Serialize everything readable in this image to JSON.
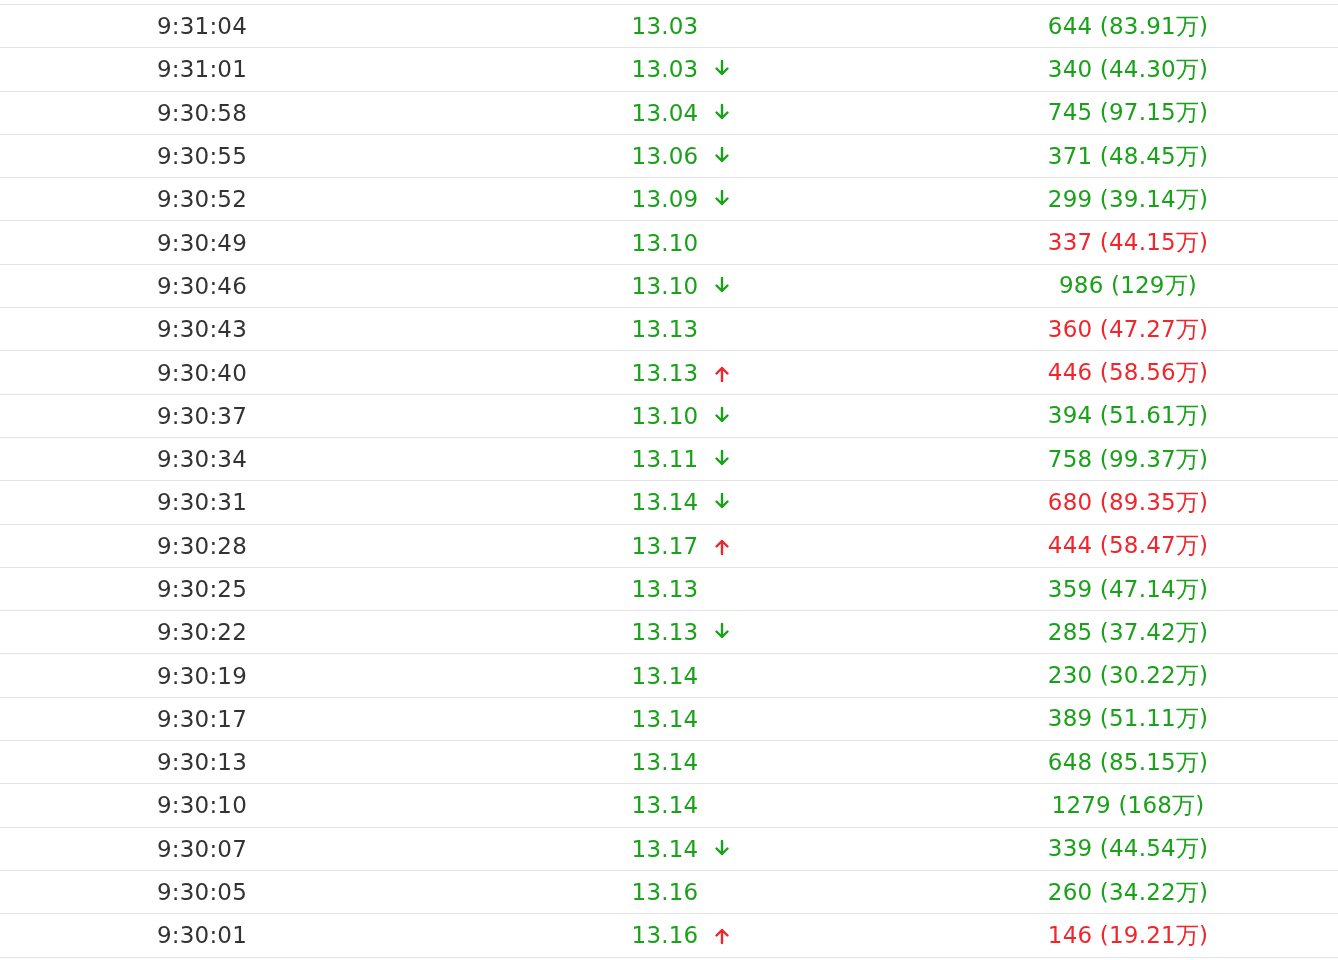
{
  "rows": [
    {
      "time": "9:31:04",
      "price": "13.03",
      "up": false,
      "down": false,
      "volume": "644 (83.91万)",
      "color": "#1aa11a"
    },
    {
      "time": "9:31:01",
      "price": "13.03",
      "up": false,
      "down": true,
      "volume": "340 (44.30万)",
      "color": "#1aa11a"
    },
    {
      "time": "9:30:58",
      "price": "13.04",
      "up": false,
      "down": true,
      "volume": "745 (97.15万)",
      "color": "#1aa11a"
    },
    {
      "time": "9:30:55",
      "price": "13.06",
      "up": false,
      "down": true,
      "volume": "371 (48.45万)",
      "color": "#1aa11a"
    },
    {
      "time": "9:30:52",
      "price": "13.09",
      "up": false,
      "down": true,
      "volume": "299 (39.14万)",
      "color": "#1aa11a"
    },
    {
      "time": "9:30:49",
      "price": "13.10",
      "up": false,
      "down": false,
      "volume": "337 (44.15万)",
      "color": "#f0262c"
    },
    {
      "time": "9:30:46",
      "price": "13.10",
      "up": false,
      "down": true,
      "volume": "986 (129万)",
      "color": "#1aa11a"
    },
    {
      "time": "9:30:43",
      "price": "13.13",
      "up": false,
      "down": false,
      "volume": "360 (47.27万)",
      "color": "#f0262c"
    },
    {
      "time": "9:30:40",
      "price": "13.13",
      "up": true,
      "down": false,
      "volume": "446 (58.56万)",
      "color": "#f0262c"
    },
    {
      "time": "9:30:37",
      "price": "13.10",
      "up": false,
      "down": true,
      "volume": "394 (51.61万)",
      "color": "#1aa11a"
    },
    {
      "time": "9:30:34",
      "price": "13.11",
      "up": false,
      "down": true,
      "volume": "758 (99.37万)",
      "color": "#1aa11a"
    },
    {
      "time": "9:30:31",
      "price": "13.14",
      "up": false,
      "down": true,
      "volume": "680 (89.35万)",
      "color": "#f0262c"
    },
    {
      "time": "9:30:28",
      "price": "13.17",
      "up": true,
      "down": false,
      "volume": "444 (58.47万)",
      "color": "#f0262c"
    },
    {
      "time": "9:30:25",
      "price": "13.13",
      "up": false,
      "down": false,
      "volume": "359 (47.14万)",
      "color": "#1aa11a"
    },
    {
      "time": "9:30:22",
      "price": "13.13",
      "up": false,
      "down": true,
      "volume": "285 (37.42万)",
      "color": "#1aa11a"
    },
    {
      "time": "9:30:19",
      "price": "13.14",
      "up": false,
      "down": false,
      "volume": "230 (30.22万)",
      "color": "#1aa11a"
    },
    {
      "time": "9:30:17",
      "price": "13.14",
      "up": false,
      "down": false,
      "volume": "389 (51.11万)",
      "color": "#1aa11a"
    },
    {
      "time": "9:30:13",
      "price": "13.14",
      "up": false,
      "down": false,
      "volume": "648 (85.15万)",
      "color": "#1aa11a"
    },
    {
      "time": "9:30:10",
      "price": "13.14",
      "up": false,
      "down": false,
      "volume": "1279 (168万)",
      "color": "#1aa11a"
    },
    {
      "time": "9:30:07",
      "price": "13.14",
      "up": false,
      "down": true,
      "volume": "339 (44.54万)",
      "color": "#1aa11a"
    },
    {
      "time": "9:30:05",
      "price": "13.16",
      "up": false,
      "down": false,
      "volume": "260 (34.22万)",
      "color": "#1aa11a"
    },
    {
      "time": "9:30:01",
      "price": "13.16",
      "up": true,
      "down": false,
      "volume": "146 (19.21万)",
      "color": "#f0262c"
    }
  ]
}
